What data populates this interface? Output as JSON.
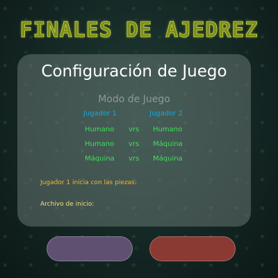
{
  "header": {
    "title": "FINALES DE AJEDREZ"
  },
  "panel": {
    "title": "Configuración de Juego",
    "mode_title": "Modo de Juego",
    "player1_label": "Jugador 1",
    "player2_label": "Jugador 2",
    "modes": [
      {
        "left": "Humano",
        "vs": "vrs",
        "right": "Humano"
      },
      {
        "left": "Humano",
        "vs": "vrs",
        "right": "Máquina"
      },
      {
        "left": "Máquina",
        "vs": "vrs",
        "right": "Máquina"
      }
    ],
    "start_pieces_label": "Jugador 1 inicia con las piezas:",
    "start_file_label": "Archivo de inicio:"
  },
  "colors": {
    "title": "#7c8a1e",
    "panel_title": "#ffffff",
    "player_headers": "#1ea6d8",
    "mode_options": "#3fe05a",
    "start_pieces": "#f5b82a",
    "start_file": "#f2e07a",
    "button_left": "#5f5072",
    "button_right": "#8a3a32"
  }
}
